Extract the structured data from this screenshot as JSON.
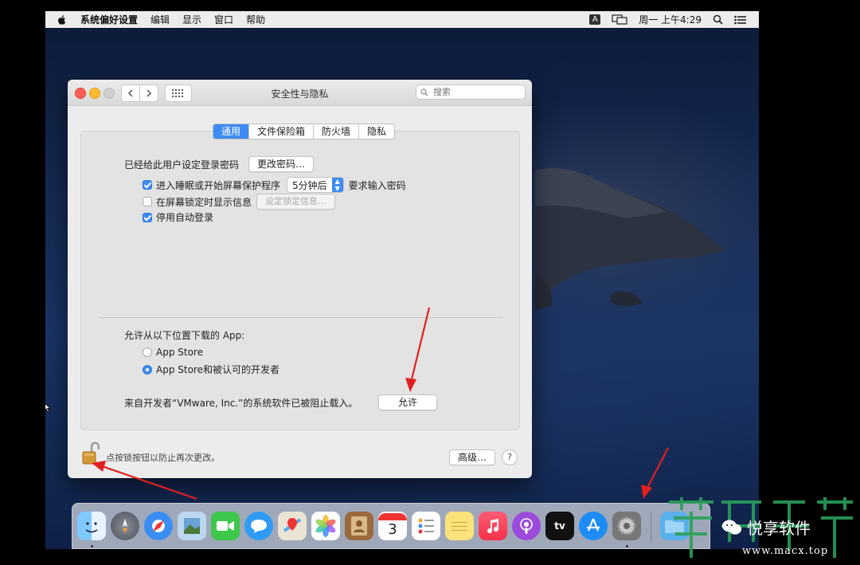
{
  "menubar": {
    "app_name": "系统偏好设置",
    "items": [
      "编辑",
      "显示",
      "窗口",
      "帮助"
    ],
    "input_indicator": "A",
    "clock": "周一 上午4:29"
  },
  "window": {
    "title": "安全性与隐私",
    "search_placeholder": "搜索",
    "tabs": [
      "通用",
      "文件保险箱",
      "防火墙",
      "隐私"
    ],
    "active_tab": 0,
    "password_label": "已经给此用户设定登录密码",
    "change_password_button": "更改密码…",
    "sleep_checkbox": {
      "label": "进入睡眠或开始屏幕保护程序",
      "checked": true
    },
    "sleep_select_value": "5分钟后",
    "require_password_label": "要求输入密码",
    "lock_message_checkbox": {
      "label": "在屏幕锁定时显示信息",
      "checked": false
    },
    "lock_message_button": "设定锁定信息…",
    "disable_autologin_checkbox": {
      "label": "停用自动登录",
      "checked": true
    },
    "download_heading": "允许从以下位置下载的 App:",
    "radio_appstore": "App Store",
    "radio_identified": "App Store和被认可的开发者",
    "selected_radio": "identified",
    "blocked_message": "来自开发者“VMware, Inc.”的系统软件已被阻止载入。",
    "allow_button": "允许",
    "lock_text": "点按锁按钮以防止再次更改。",
    "advanced_button": "高级…",
    "help_button": "?"
  },
  "dock": {
    "icons": [
      "finder-icon",
      "launchpad-icon",
      "safari-icon",
      "preview-icon",
      "facetime-icon",
      "messages-icon",
      "maps-icon",
      "photos-icon",
      "contacts-icon",
      "calendar-icon",
      "reminders-icon",
      "notes-icon",
      "music-icon",
      "podcasts-icon",
      "tv-icon",
      "app-store-icon",
      "system-preferences-icon"
    ],
    "calendar_day": "3",
    "tv_label": "tv"
  },
  "watermark": {
    "name": "悦享软件",
    "url": "www.macx.top"
  },
  "colors": {
    "accent": "#3d8cf2",
    "annotation_red": "#e02020"
  }
}
